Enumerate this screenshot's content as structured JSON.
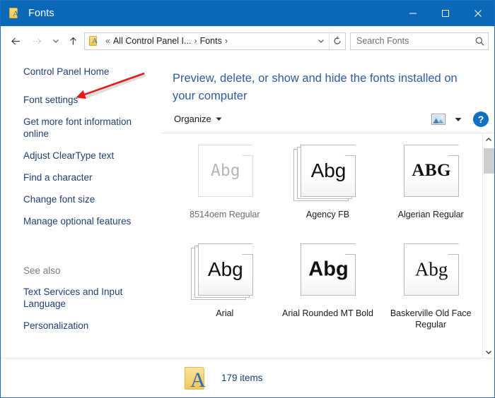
{
  "window": {
    "title": "Fonts",
    "title_icon": "fonts-folder-icon",
    "minimize_label": "─",
    "maximize_label": "□",
    "close_label": "✕"
  },
  "navbar": {
    "back_icon": "back-arrow-icon",
    "forward_icon": "forward-arrow-icon",
    "recent_icon": "chevron-down-icon",
    "up_icon": "up-arrow-icon",
    "address_icon": "fonts-folder-icon",
    "breadcrumb_prefix": "«",
    "breadcrumbs": [
      {
        "label": "All Control Panel I...",
        "separator": "›"
      },
      {
        "label": "Fonts",
        "separator": "›"
      }
    ],
    "dropdown_icon": "chevron-down-icon",
    "refresh_icon": "refresh-icon"
  },
  "search": {
    "placeholder": "Search Fonts",
    "value": "",
    "icon": "search-icon"
  },
  "sidebar": {
    "items": [
      {
        "label": "Control Panel Home"
      },
      {
        "label": "Font settings"
      },
      {
        "label": "Get more font information online"
      },
      {
        "label": "Adjust ClearType text"
      },
      {
        "label": "Find a character"
      },
      {
        "label": "Change font size"
      },
      {
        "label": "Manage optional features"
      }
    ],
    "see_also_label": "See also",
    "see_also_items": [
      {
        "label": "Text Services and Input Language"
      },
      {
        "label": "Personalization"
      }
    ]
  },
  "main": {
    "heading": "Preview, delete, or show and hide the fonts installed on your computer",
    "toolbar": {
      "organize_label": "Organize",
      "organize_caret": "chevron-down-icon",
      "view_icon": "view-layout-icon",
      "view_caret": "chevron-down-icon",
      "help_label": "?"
    },
    "fonts": [
      {
        "name": "8514oem Regular",
        "sample": "Abg",
        "style": "s-mono",
        "stacked": false,
        "hidden": true
      },
      {
        "name": "Agency FB",
        "sample": "Abg",
        "style": "s-sans",
        "stacked": true,
        "hidden": false
      },
      {
        "name": "Algerian Regular",
        "sample": "ABG",
        "style": "s-serif",
        "stacked": false,
        "hidden": false
      },
      {
        "name": "Arial",
        "sample": "Abg",
        "style": "s-sans",
        "stacked": true,
        "hidden": false
      },
      {
        "name": "Arial Rounded MT Bold",
        "sample": "Abg",
        "style": "s-bold",
        "stacked": false,
        "hidden": false
      },
      {
        "name": "Baskerville Old Face Regular",
        "sample": "Abg",
        "style": "s-serif2",
        "stacked": false,
        "hidden": false
      }
    ],
    "scrollbar": {
      "up_icon": "chevron-up-icon",
      "down_icon": "chevron-down-icon"
    }
  },
  "status": {
    "folder_icon": "fonts-folder-icon",
    "item_count_label": "179 items"
  },
  "annotation": {
    "type": "red-arrow",
    "color": "#e01b1b",
    "points_to": "Font settings"
  },
  "colors": {
    "titlebar": "#0a68b8",
    "heading": "#2f5c9e",
    "link": "#1f3f73",
    "accent": "#1071c4",
    "annotation": "#e01b1b"
  }
}
